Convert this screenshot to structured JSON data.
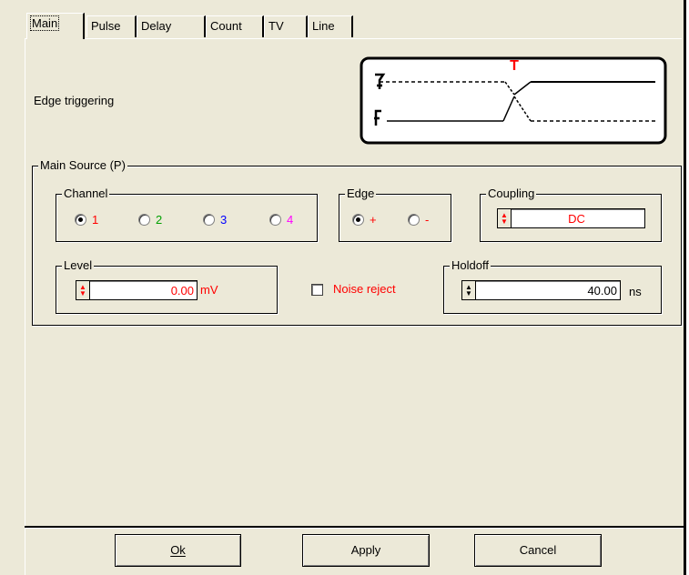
{
  "tabs": [
    "Main",
    "Pulse",
    "Delay",
    "Count",
    "TV",
    "Line"
  ],
  "description": "Edge triggering",
  "diagram": {
    "marker": "T"
  },
  "main_source": {
    "label": "Main Source (P)",
    "channel": {
      "label": "Channel",
      "options": [
        "1",
        "2",
        "3",
        "4"
      ],
      "selected": "1"
    },
    "edge": {
      "label": "Edge",
      "options": [
        "+",
        "-"
      ],
      "selected": "+"
    },
    "coupling": {
      "label": "Coupling",
      "value": "DC"
    },
    "level": {
      "label": "Level",
      "value": "0.00",
      "unit": "mV"
    },
    "noise_reject": {
      "label": "Noise reject",
      "checked": false
    },
    "holdoff": {
      "label": "Holdoff",
      "value": "40.00",
      "unit": "ns"
    }
  },
  "buttons": {
    "ok": "Ok",
    "apply": "Apply",
    "cancel": "Cancel"
  },
  "colors": {
    "channel1": "#ff0000",
    "channel2": "#00a000",
    "channel3": "#0000ff",
    "channel4": "#ff00ff",
    "accent_red": "#ff0000"
  }
}
